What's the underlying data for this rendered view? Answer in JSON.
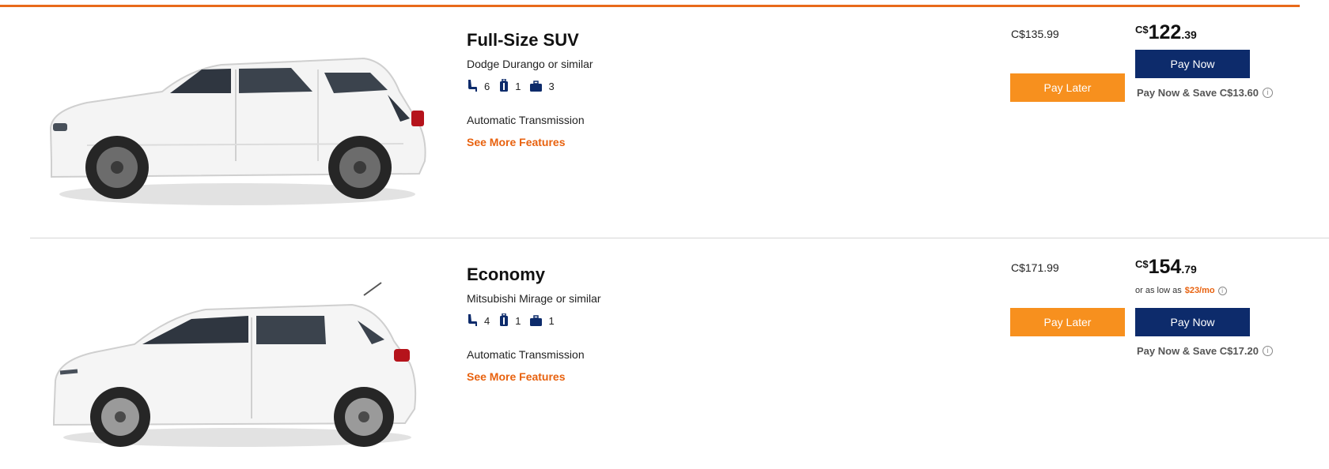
{
  "vehicles": [
    {
      "class": "Full-Size SUV",
      "model": "Dodge Durango or similar",
      "seats": "6",
      "bags_large": "1",
      "bags_small": "3",
      "transmission": "Automatic Transmission",
      "more_link": "See More Features",
      "old_price": "C$135.99",
      "price": {
        "currency": "C$",
        "whole": "122",
        "cents": ".39"
      },
      "pay_later": "Pay Later",
      "pay_now": "Pay Now",
      "save_note": "Pay Now & Save C$13.60",
      "image_icon": "white-suv-side-view"
    },
    {
      "class": "Economy",
      "model": "Mitsubishi Mirage or similar",
      "seats": "4",
      "bags_large": "1",
      "bags_small": "1",
      "transmission": "Automatic Transmission",
      "more_link": "See More Features",
      "old_price": "C$171.99",
      "price": {
        "currency": "C$",
        "whole": "154",
        "cents": ".79"
      },
      "low_price_prefix": "or as low as",
      "low_price_amount": "$23/mo",
      "pay_later": "Pay Later",
      "pay_now": "Pay Now",
      "save_note": "Pay Now & Save C$17.20",
      "image_icon": "white-hatchback-side-view"
    }
  ],
  "icons": {
    "seat": "seat-icon",
    "large_bag": "suitcase-icon",
    "small_bag": "briefcase-icon",
    "info": "info-icon"
  },
  "colors": {
    "accent_orange": "#e86a1a",
    "pay_later_bg": "#f7901e",
    "pay_now_bg": "#0d2b6b",
    "icon_navy": "#0d2b6b"
  }
}
